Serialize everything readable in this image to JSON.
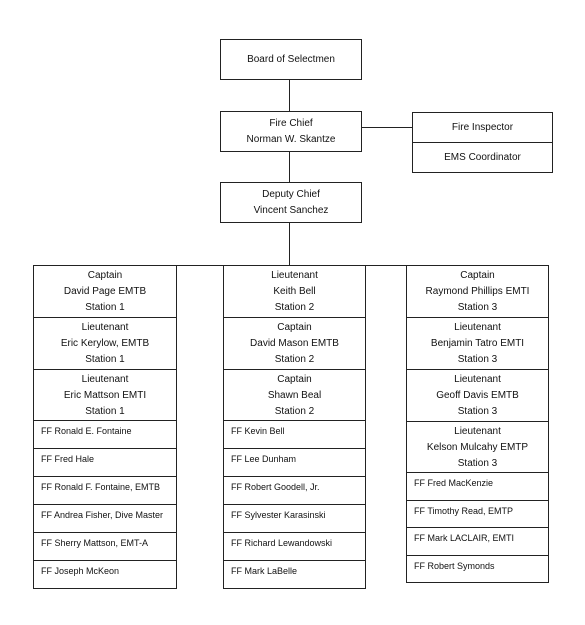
{
  "top": {
    "board": "Board of Selectmen",
    "chief_title": "Fire Chief",
    "chief_name": "Norman W. Skantze",
    "inspector": "Fire Inspector",
    "ems": "EMS Coordinator",
    "deputy_title": "Deputy Chief",
    "deputy_name": "Vincent Sanchez"
  },
  "columns": [
    {
      "officers": [
        [
          "Captain",
          "David Page EMTB",
          "Station 1"
        ],
        [
          "Lieutenant",
          "Eric Kerylow, EMTB",
          "Station 1"
        ],
        [
          "Lieutenant",
          "Eric Mattson EMTI",
          "Station 1"
        ]
      ],
      "firefighters": [
        "FF Ronald E. Fontaine",
        "FF Fred Hale",
        "FF Ronald F. Fontaine, EMTB",
        "FF Andrea Fisher, Dive Master",
        "FF Sherry Mattson, EMT-A",
        "FF Joseph McKeon"
      ]
    },
    {
      "officers": [
        [
          "Lieutenant",
          "Keith Bell",
          "Station 2"
        ],
        [
          "Captain",
          "David Mason EMTB",
          "Station 2"
        ],
        [
          "Captain",
          "Shawn Beal",
          "Station 2"
        ]
      ],
      "firefighters": [
        "FF Kevin Bell",
        "FF Lee Dunham",
        "FF Robert Goodell, Jr.",
        "FF Sylvester Karasinski",
        "FF Richard Lewandowski",
        "FF Mark LaBelle"
      ]
    },
    {
      "officers": [
        [
          "Captain",
          "Raymond Phillips EMTI",
          "Station 3"
        ],
        [
          "Lieutenant",
          "Benjamin Tatro EMTI",
          "Station 3"
        ],
        [
          "Lieutenant",
          "Geoff Davis EMTB",
          "Station 3"
        ],
        [
          "Lieutenant",
          "Kelson Mulcahy EMTP",
          "Station 3"
        ]
      ],
      "firefighters": [
        "FF Fred MacKenzie",
        "FF Timothy Read, EMTP",
        "FF Mark LACLAIR, EMTI",
        "FF Robert Symonds"
      ]
    }
  ]
}
